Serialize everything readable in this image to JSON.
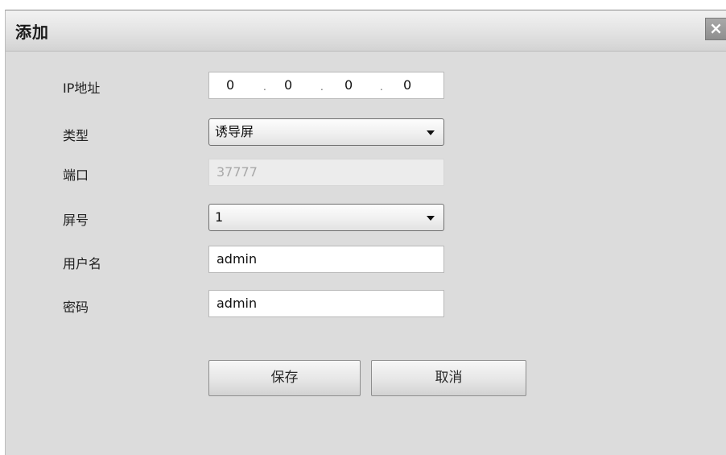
{
  "dialog": {
    "title": "添加",
    "close_glyph": "×"
  },
  "form": {
    "ip": {
      "label": "IP地址",
      "octets": [
        "0",
        "0",
        "0",
        "0"
      ],
      "separator": "."
    },
    "type": {
      "label": "类型",
      "value": "诱导屏"
    },
    "port": {
      "label": "端口",
      "value": "37777"
    },
    "screen_no": {
      "label": "屏号",
      "value": "1"
    },
    "username": {
      "label": "用户名",
      "value": "admin"
    },
    "password": {
      "label": "密码",
      "value": "admin"
    }
  },
  "buttons": {
    "save": "保存",
    "cancel": "取消"
  },
  "icons": {
    "close": "close-icon",
    "dropdown": "chevron-down-icon"
  },
  "colors": {
    "dialog_bg": "#dcdcdc",
    "title_bg": "#e6e6e6",
    "close_bg": "#9b9b9b",
    "disabled_text": "#a8a8a8"
  }
}
